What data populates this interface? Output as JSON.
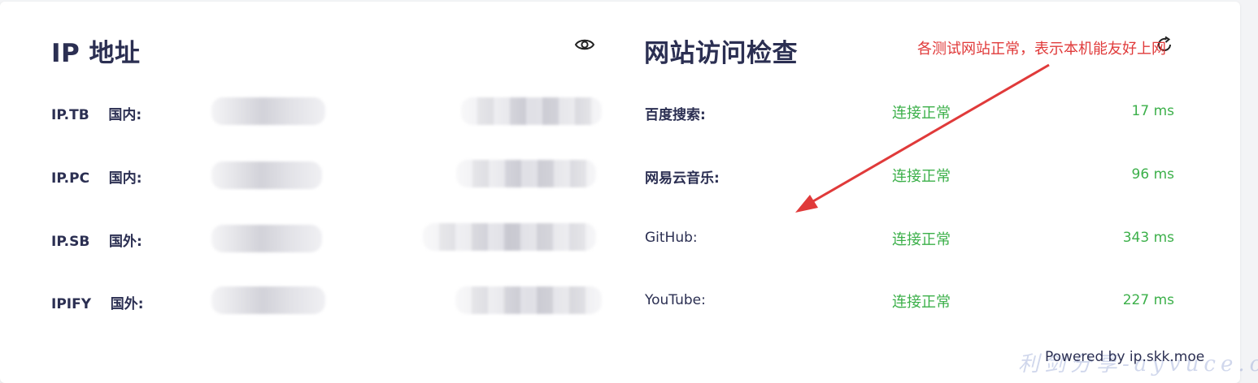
{
  "ip_panel": {
    "title": "IP 地址",
    "rows": [
      {
        "label": "IP.TB    国内:"
      },
      {
        "label": "IP.PC    国内:"
      },
      {
        "label": "IP.SB    国外:"
      },
      {
        "label": "IPIFY    国外:"
      }
    ]
  },
  "check_panel": {
    "title": "网站访问检查",
    "sites": [
      {
        "name": "百度搜索:",
        "status": "连接正常",
        "latency": "17 ms"
      },
      {
        "name": "网易云音乐:",
        "status": "连接正常",
        "latency": "96 ms"
      },
      {
        "name": "GitHub:",
        "status": "连接正常",
        "latency": "343 ms"
      },
      {
        "name": "YouTube:",
        "status": "连接正常",
        "latency": "227 ms"
      }
    ]
  },
  "annotation": {
    "text": "各测试网站正常，表示本机能友好上网",
    "color": "#e03a3a"
  },
  "footer": {
    "powered_by": "Powered by ip.skk.moe"
  },
  "watermark": {
    "text": "利剑分享-ayvuce.com"
  },
  "colors": {
    "title": "#2b2f52",
    "ok": "#3cb04a",
    "annotation": "#e03a3a"
  },
  "icons": {
    "toggle_visibility": "eye-icon",
    "refresh": "refresh-icon"
  }
}
